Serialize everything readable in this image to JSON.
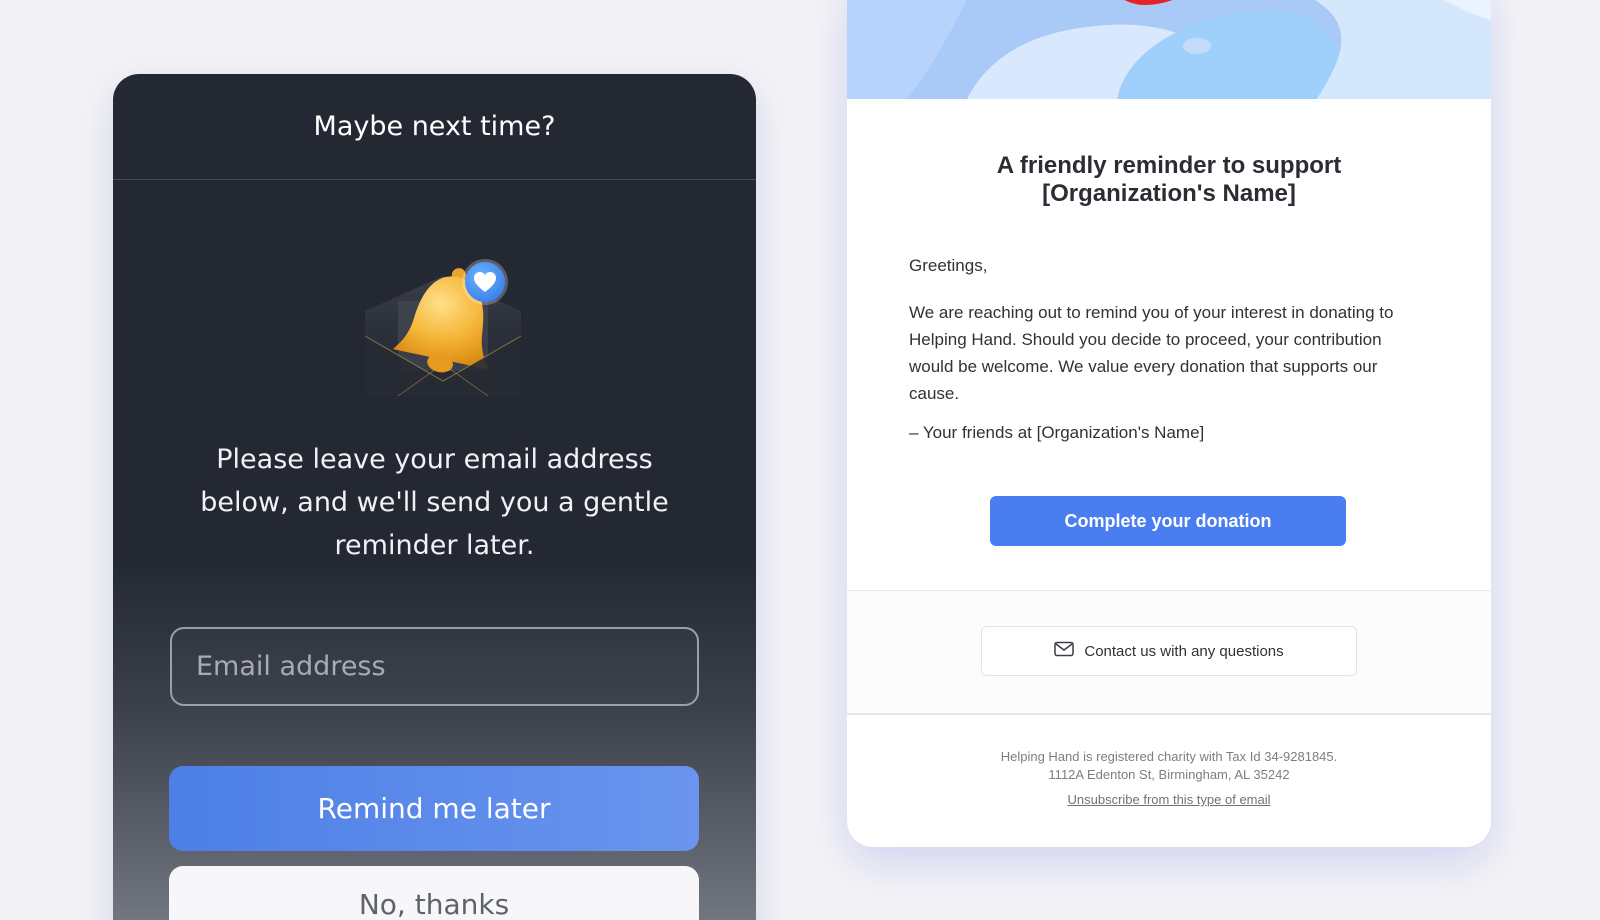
{
  "modal": {
    "title": "Maybe next time?",
    "prompt": "Please leave your email address below, and we'll send you a gentle reminder later.",
    "email_placeholder": "Email address",
    "remind_label": "Remind me later",
    "decline_label": "No, thanks",
    "illustration_icon": "bell-envelope-heart-icon"
  },
  "email": {
    "heading_line1": "A friendly reminder to support",
    "heading_line2": "[Organization's Name]",
    "greeting": "Greetings,",
    "body": "We are reaching out to remind you of your interest in donating to Helping Hand. Should you decide to proceed, your contribution would be welcome. We value every donation that supports our cause.",
    "signoff": "– Your friends at [Organization's Name]",
    "cta_label": "Complete your donation",
    "contact_label": "Contact us with any questions",
    "contact_icon": "mail-icon",
    "footer_line1": "Helping Hand is registered charity with Tax Id 34-9281845.",
    "footer_line2": "1112A Edenton St, Birmingham, AL 35242",
    "unsubscribe_label": "Unsubscribe from this type of email"
  },
  "colors": {
    "modal_bg": "#232833",
    "accent_blue": "#4a7ef0",
    "page_bg": "#f3f3f6",
    "hero_red": "#e8202a"
  }
}
